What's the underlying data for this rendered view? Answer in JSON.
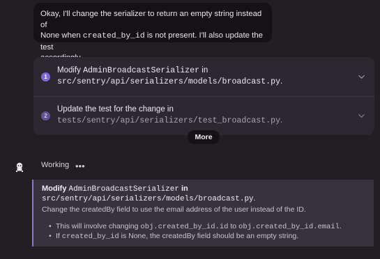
{
  "message": {
    "line1": "Okay, I'll change the serializer to return an empty string instead of",
    "line2_pre": "None when ",
    "line2_code": "created_by_id",
    "line2_post": " is not present. I'll also update the test",
    "line3": "accordingly."
  },
  "steps": [
    {
      "number": "1",
      "line1_pre": "Modify ",
      "line1_code": "AdminBroadcastSerializer",
      "line1_post": " in",
      "path": "src/sentry/api/serializers/models/broadcast.py",
      "path_suffix": ".",
      "icon": "chevron-down-icon"
    },
    {
      "number": "2",
      "line1": "Update the test for the change in",
      "path": "tests/sentry/api/serializers/test_broadcast.py",
      "path_suffix": ".",
      "icon": "chevron-down-icon"
    }
  ],
  "more_label": "More",
  "working": {
    "label": "Working",
    "dots": "•••",
    "avatar_icon": "bot-avatar-icon"
  },
  "plan": {
    "title_pre": "Modify ",
    "title_code": "AdminBroadcastSerializer",
    "title_post": " in",
    "path": "src/sentry/api/serializers/models/broadcast.py",
    "path_suffix": ".",
    "desc": "Change the createdBy field to use the email address of the user instead of the ID.",
    "bullet1_pre": "This will involve changing ",
    "bullet1_code1": "obj.created_by_id.id",
    "bullet1_mid": " to ",
    "bullet1_code2": "obj.created_by_id.email",
    "bullet1_post": ".",
    "bullet2_pre": "If ",
    "bullet2_code": "created_by_id",
    "bullet2_post": " is None, the createdBy field should be an empty string.",
    "accent_color": "#8a74dc"
  }
}
